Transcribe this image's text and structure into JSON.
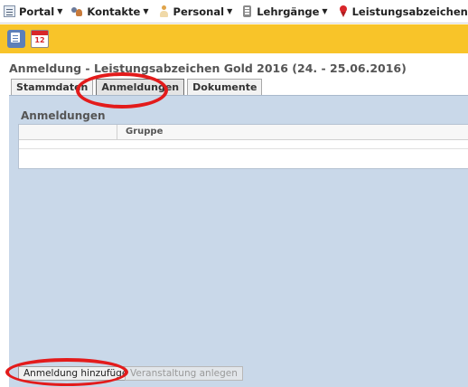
{
  "menu": {
    "items": [
      {
        "label": "Portal",
        "icon": "portal-icon"
      },
      {
        "label": "Kontakte",
        "icon": "contacts-icon"
      },
      {
        "label": "Personal",
        "icon": "person-icon"
      },
      {
        "label": "Lehrgänge",
        "icon": "course-book-icon"
      },
      {
        "label": "Leistungsabzeichen",
        "icon": "award-ribbon-icon"
      }
    ]
  },
  "toolbar": {
    "buttons": [
      {
        "icon": "invoice-icon"
      },
      {
        "icon": "calendar-icon",
        "day": "12"
      }
    ],
    "background": "#f8c429"
  },
  "page": {
    "title": "Anmeldung - Leistungsabzeichen Gold 2016 (24. - 25.06.2016)"
  },
  "tabs": [
    {
      "label": "Stammdaten",
      "active": false
    },
    {
      "label": "Anmeldungen",
      "active": true
    },
    {
      "label": "Dokumente",
      "active": false
    }
  ],
  "panel": {
    "section_title": "Anmeldungen",
    "columns": [
      "",
      "Gruppe"
    ],
    "background": "#c9d8e9"
  },
  "buttons": {
    "add_registration": "Anmeldung hinzufügen",
    "create_event": "Veranstaltung anlegen"
  },
  "annotation": {
    "color": "#e31b1b"
  }
}
